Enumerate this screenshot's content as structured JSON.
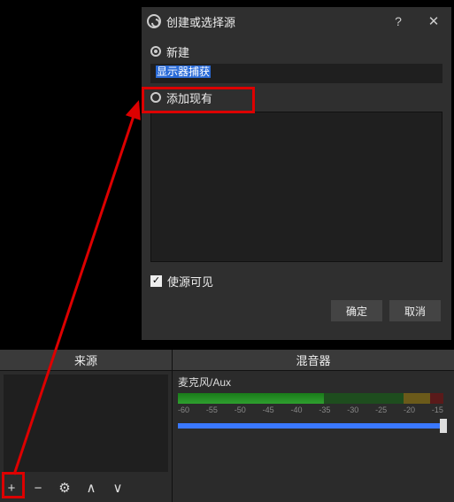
{
  "dialog": {
    "title": "创建或选择源",
    "help": "?",
    "close": "✕",
    "radio_new": "新建",
    "radio_existing": "添加现有",
    "input_value": "显示器捕获",
    "visible_label": "使源可见",
    "ok": "确定",
    "cancel": "取消"
  },
  "panels": {
    "sources_header": "来源",
    "mixer_header": "混音器"
  },
  "mixer": {
    "track_label": "麦克风/Aux",
    "scale": [
      "-60",
      "-55",
      "-50",
      "-45",
      "-40",
      "-35",
      "-30",
      "-25",
      "-20",
      "-15"
    ]
  },
  "toolbar": {
    "add": "+",
    "remove": "−",
    "settings": "⚙",
    "up": "∧",
    "down": "∨"
  }
}
